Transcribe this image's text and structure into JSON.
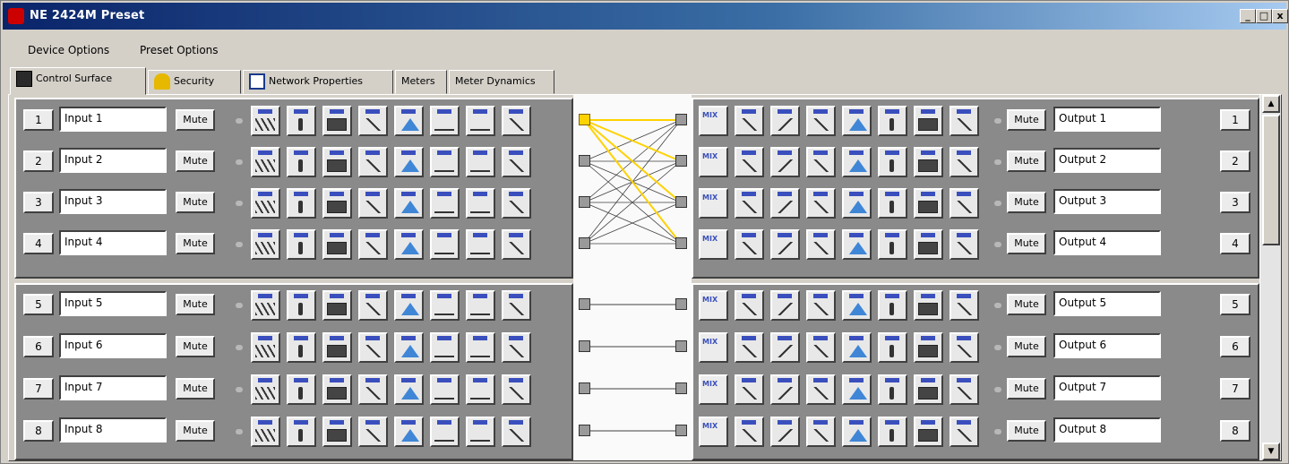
{
  "window": {
    "title": "NE 2424M   Preset",
    "controls": {
      "minimize": "_",
      "maximize": "□",
      "close": "x"
    }
  },
  "menu": {
    "items": [
      "Device Options",
      "Preset Options"
    ]
  },
  "tabs": [
    {
      "label": "Control Surface",
      "icon": "control-surface-icon",
      "active": true
    },
    {
      "label": "Security",
      "icon": "lock-icon",
      "active": false
    },
    {
      "label": "Network Properties",
      "icon": "network-icon",
      "active": false
    },
    {
      "label": "Meters",
      "active": false
    },
    {
      "label": "Meter Dynamics",
      "active": false
    }
  ],
  "inputs": [
    {
      "num": "1",
      "name": "Input 1",
      "mute": "Mute"
    },
    {
      "num": "2",
      "name": "Input 2",
      "mute": "Mute"
    },
    {
      "num": "3",
      "name": "Input 3",
      "mute": "Mute"
    },
    {
      "num": "4",
      "name": "Input 4",
      "mute": "Mute"
    },
    {
      "num": "5",
      "name": "Input 5",
      "mute": "Mute"
    },
    {
      "num": "6",
      "name": "Input 6",
      "mute": "Mute"
    },
    {
      "num": "7",
      "name": "Input 7",
      "mute": "Mute"
    },
    {
      "num": "8",
      "name": "Input 8",
      "mute": "Mute"
    }
  ],
  "outputs": [
    {
      "num": "1",
      "name": "Output 1",
      "mute": "Mute"
    },
    {
      "num": "2",
      "name": "Output 2",
      "mute": "Mute"
    },
    {
      "num": "3",
      "name": "Output 3",
      "mute": "Mute"
    },
    {
      "num": "4",
      "name": "Output 4",
      "mute": "Mute"
    },
    {
      "num": "5",
      "name": "Output 5",
      "mute": "Mute"
    },
    {
      "num": "6",
      "name": "Output 6",
      "mute": "Mute"
    },
    {
      "num": "7",
      "name": "Output 7",
      "mute": "Mute"
    },
    {
      "num": "8",
      "name": "Output 8",
      "mute": "Mute"
    }
  ],
  "input_modules": [
    "peq-module",
    "gain-module",
    "meter-module",
    "delay-module",
    "eq-module",
    "gate-module",
    "level-module",
    "noise-module"
  ],
  "output_modules": [
    "mix-module",
    "hpf-module",
    "lpf-module",
    "delay-module",
    "eq-module",
    "gain-module",
    "meter-module",
    "limiter-module"
  ],
  "mix_label": "MIX",
  "router": {
    "selected_input": "1",
    "colors": {
      "selected_route": "#ffd200",
      "route": "#404040"
    }
  }
}
